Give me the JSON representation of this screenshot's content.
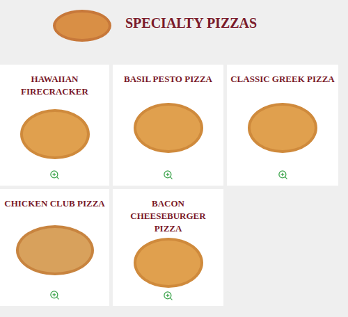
{
  "header": {
    "title": "SPECIALTY PIZZAS"
  },
  "pizzas": [
    {
      "name": "HAWAIIAN FIRECRACKER"
    },
    {
      "name": "BASIL PESTO PIZZA"
    },
    {
      "name": "CLASSIC GREEK PIZZA"
    },
    {
      "name": "CHICKEN CLUB PIZZA"
    },
    {
      "name": "BACON CHEESEBURGER PIZZA"
    }
  ]
}
